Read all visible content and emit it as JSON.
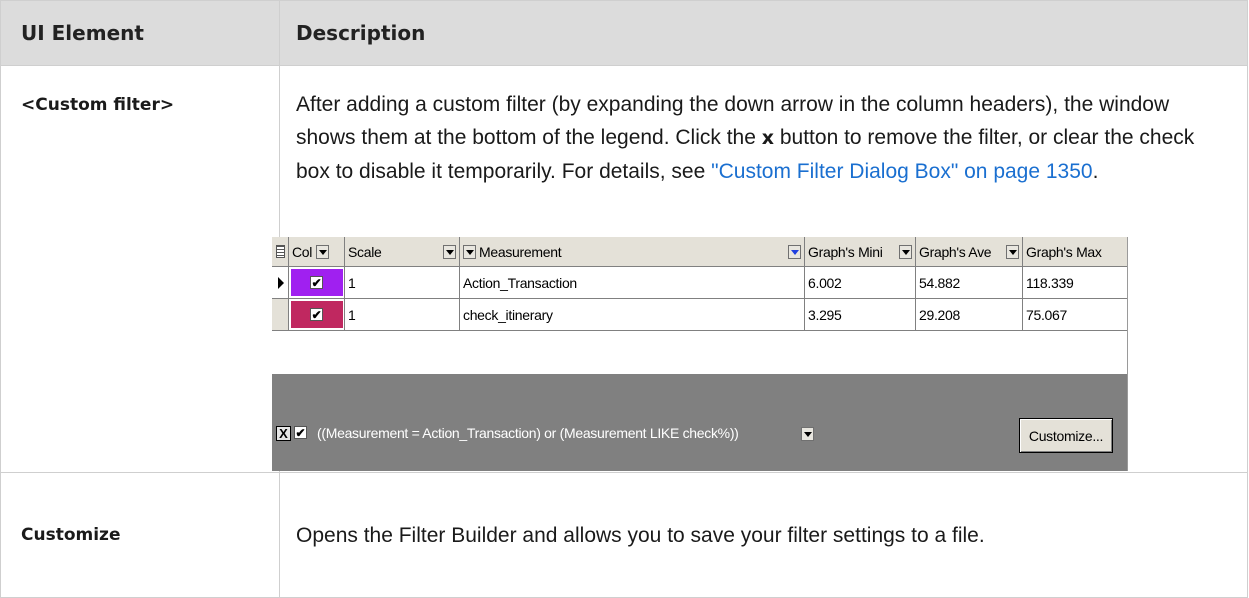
{
  "table": {
    "header": {
      "col1": "UI Element",
      "col2": "Description"
    },
    "rows": [
      {
        "element": "<Custom filter>",
        "desc_part1": "After adding a custom filter (by expanding the down arrow in the column headers), the window shows them at the bottom of the legend. Click the ",
        "desc_bold": "x",
        "desc_part2": " button to remove the filter, or clear the check box to disable it temporarily. For details, see ",
        "desc_link": "\"Custom Filter Dialog Box\" on page 1350",
        "desc_end": "."
      },
      {
        "element": "Customize",
        "desc": "Opens the Filter Builder and allows you to save your filter settings to a file."
      }
    ]
  },
  "legend": {
    "columns": [
      "Col",
      "Scale",
      "Measurement",
      "Graph's Mini",
      "Graph's Ave",
      "Graph's Max"
    ],
    "rows": [
      {
        "color": "#a020f0",
        "checked": "✔",
        "scale": "1",
        "measurement": "Action_Transaction",
        "min": "6.002",
        "ave": "54.882",
        "max": "118.339"
      },
      {
        "color": "#c02860",
        "checked": "✔",
        "scale": "1",
        "measurement": "check_itinerary",
        "min": "3.295",
        "ave": "29.208",
        "max": "75.067"
      }
    ],
    "filter": {
      "remove_label": "X",
      "checked": "✔",
      "expression": "((Measurement = Action_Transaction) or (Measurement LIKE check%))",
      "customize_label": "Customize..."
    }
  },
  "colors": {
    "header_bg": "#dcdcdc",
    "link": "#1a6fd0",
    "filter_bar": "#808080"
  }
}
